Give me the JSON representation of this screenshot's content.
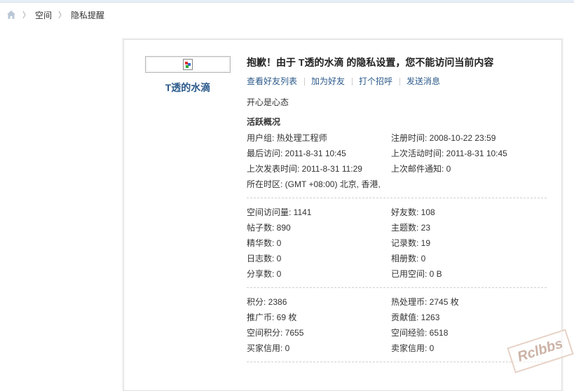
{
  "breadcrumb": {
    "home_icon": "home-icon",
    "items": [
      "空间",
      "隐私提醒"
    ]
  },
  "profile": {
    "username": "T透的水滴",
    "avatar_icon": "broken-image-icon",
    "notice": "抱歉！由于 T透的水滴 的隐私设置，您不能访问当前内容",
    "actions": [
      "查看好友列表",
      "加为好友",
      "打个招呼",
      "发送消息"
    ],
    "motto": "开心是心态",
    "section_title": "活跃概况"
  },
  "activity": [
    [
      "用户组: 热处理工程师",
      "注册时间: 2008-10-22 23:59"
    ],
    [
      "最后访问: 2011-8-31 10:45",
      "上次活动时间: 2011-8-31 10:45"
    ],
    [
      "上次发表时间: 2011-8-31 11:29",
      "上次邮件通知: 0"
    ]
  ],
  "timezone": "所在时区: (GMT +08:00) 北京, 香港,",
  "stats": [
    [
      "空间访问量: 1141",
      "好友数: 108"
    ],
    [
      "帖子数: 890",
      "主题数: 23"
    ],
    [
      "精华数: 0",
      "记录数: 19"
    ],
    [
      "日志数: 0",
      "相册数: 0"
    ],
    [
      "分享数: 0",
      "已用空间: 0 B"
    ]
  ],
  "credits": [
    [
      "积分: 2386",
      "热处理币: 2745 枚"
    ],
    [
      "推广币: 69 枚",
      "贡献值: 1263"
    ],
    [
      "空间积分: 7655",
      "空间经验: 6518"
    ],
    [
      "买家信用: 0",
      "卖家信用: 0"
    ]
  ],
  "watermark": "Rclbbs",
  "colors": {
    "link": "#2b5a8a",
    "text": "#333333",
    "border": "#dfdfdf"
  }
}
